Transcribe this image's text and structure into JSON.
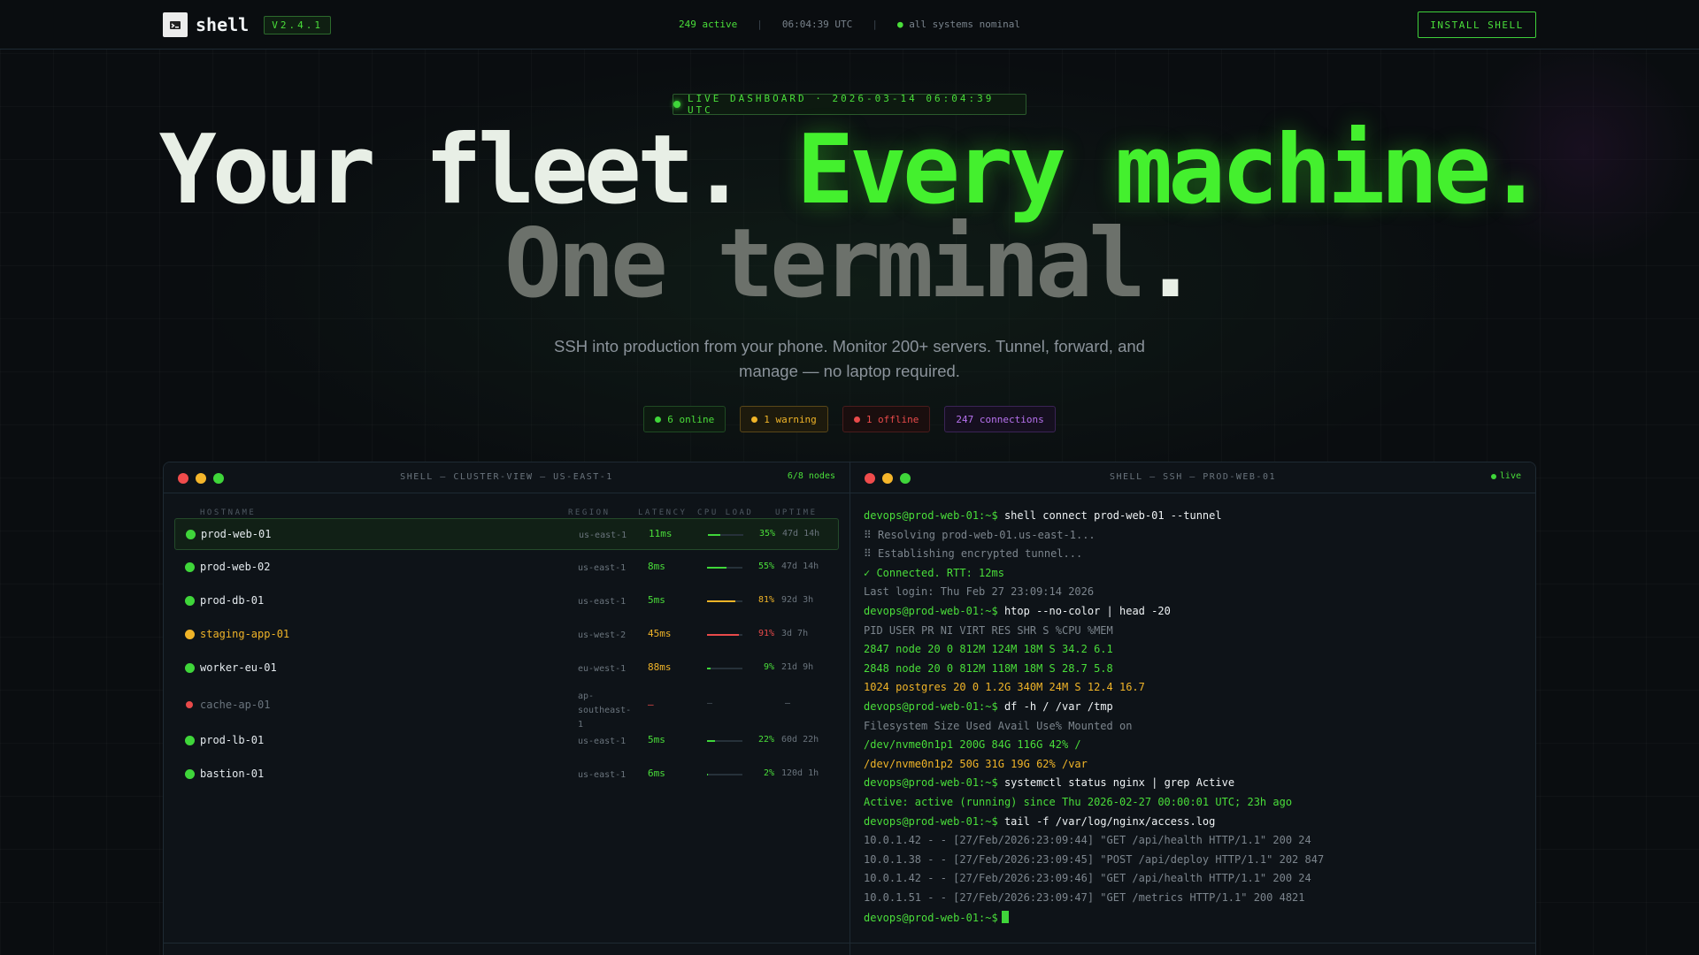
{
  "nav": {
    "brand": "shell",
    "version": "V2.4.1",
    "active": "249 active",
    "time": "06:04:39 UTC",
    "systems": "all systems nominal",
    "install": "INSTALL SHELL"
  },
  "hero": {
    "live_badge": "LIVE DASHBOARD · 2026-03-14 06:04:39 UTC",
    "line1_a": "Your fleet.",
    "line1_b": "Every machine.",
    "line2_a": "One terminal",
    "line2_b": ".",
    "subtitle": "SSH into production from your phone. Monitor 200+ servers. Tunnel, forward, and manage — no laptop required.",
    "pills": {
      "online": "6 online",
      "warning": "1 warning",
      "offline": "1 offline",
      "connections": "247 connections"
    }
  },
  "cluster": {
    "title": "SHELL — CLUSTER-VIEW — US-EAST-1",
    "nodes": "6/8 nodes",
    "headers": {
      "hostname": "HOSTNAME",
      "region": "REGION",
      "latency": "LATENCY",
      "cpu": "CPU LOAD",
      "uptime": "UPTIME"
    },
    "rows": [
      {
        "host": "prod-web-01",
        "region": "us-east-1",
        "latency": "11ms",
        "cpu": "35%",
        "cpu_frac": 0.35,
        "uptime": "47d 14h",
        "status": "online"
      },
      {
        "host": "prod-web-02",
        "region": "us-east-1",
        "latency": "8ms",
        "cpu": "55%",
        "cpu_frac": 0.55,
        "uptime": "47d 14h",
        "status": "online"
      },
      {
        "host": "prod-db-01",
        "region": "us-east-1",
        "latency": "5ms",
        "cpu": "81%",
        "cpu_frac": 0.81,
        "uptime": "92d 3h",
        "status": "online"
      },
      {
        "host": "staging-app-01",
        "region": "us-west-2",
        "latency": "45ms",
        "cpu": "91%",
        "cpu_frac": 0.91,
        "uptime": "3d 7h",
        "status": "warning"
      },
      {
        "host": "worker-eu-01",
        "region": "eu-west-1",
        "latency": "88ms",
        "cpu": "9%",
        "cpu_frac": 0.09,
        "uptime": "21d 9h",
        "status": "online"
      },
      {
        "host": "cache-ap-01",
        "region": "ap-southeast-1",
        "latency": "—",
        "cpu": "—",
        "cpu_frac": 0,
        "uptime": "—",
        "status": "offline"
      },
      {
        "host": "prod-lb-01",
        "region": "us-east-1",
        "latency": "5ms",
        "cpu": "22%",
        "cpu_frac": 0.22,
        "uptime": "60d 22h",
        "status": "online"
      },
      {
        "host": "bastion-01",
        "region": "us-east-1",
        "latency": "6ms",
        "cpu": "2%",
        "cpu_frac": 0.02,
        "uptime": "120d 1h",
        "status": "online"
      }
    ]
  },
  "ssh": {
    "title": "SHELL — SSH — PROD-WEB-01",
    "live": "live",
    "prompt": "devops@prod-web-01:~$",
    "lines": [
      {
        "kind": "cmd",
        "text": "shell connect prod-web-01 --tunnel"
      },
      {
        "kind": "dim",
        "text": "⠿ Resolving prod-web-01.us-east-1..."
      },
      {
        "kind": "dim",
        "text": "⠿ Establishing encrypted tunnel..."
      },
      {
        "kind": "ok",
        "text": "✓ Connected. RTT: 12ms"
      },
      {
        "kind": "dim",
        "text": "Last login: Thu Feb 27 23:09:14 2026"
      },
      {
        "kind": "cmd",
        "text": "htop --no-color | head -20"
      },
      {
        "kind": "dim",
        "text": "PID USER PR NI VIRT RES SHR S %CPU %MEM"
      },
      {
        "kind": "ok",
        "text": "2847 node 20 0 812M 124M 18M S 34.2 6.1"
      },
      {
        "kind": "ok",
        "text": "2848 node 20 0 812M 118M 18M S 28.7 5.8"
      },
      {
        "kind": "warn",
        "text": "1024 postgres 20 0 1.2G 340M 24M S 12.4 16.7"
      },
      {
        "kind": "cmd",
        "text": "df -h / /var /tmp"
      },
      {
        "kind": "dim",
        "text": "Filesystem Size Used Avail Use% Mounted on"
      },
      {
        "kind": "ok",
        "text": "/dev/nvme0n1p1 200G 84G 116G 42% /"
      },
      {
        "kind": "warn",
        "text": "/dev/nvme0n1p2 50G 31G 19G 62% /var"
      },
      {
        "kind": "cmd",
        "text": "systemctl status nginx | grep Active"
      },
      {
        "kind": "ok",
        "text": "Active: active (running) since Thu 2026-02-27 00:00:01 UTC; 23h ago"
      },
      {
        "kind": "cmd",
        "text": "tail -f /var/log/nginx/access.log"
      },
      {
        "kind": "dim",
        "text": "10.0.1.42 - - [27/Feb/2026:23:09:44] \"GET /api/health HTTP/1.1\" 200 24"
      },
      {
        "kind": "dim",
        "text": "10.0.1.38 - - [27/Feb/2026:23:09:45] \"POST /api/deploy HTTP/1.1\" 202 847"
      },
      {
        "kind": "dim",
        "text": "10.0.1.42 - - [27/Feb/2026:23:09:46] \"GET /api/health HTTP/1.1\" 200 24"
      },
      {
        "kind": "dim",
        "text": "10.0.1.51 - - [27/Feb/2026:23:09:47] \"GET /metrics HTTP/1.1\" 200 4821"
      },
      {
        "kind": "prompt",
        "text": ""
      }
    ]
  },
  "colors": {
    "accent": "#4ade3a",
    "warning": "#f0b428",
    "error": "#e84a4a",
    "purple": "#b772ef"
  }
}
